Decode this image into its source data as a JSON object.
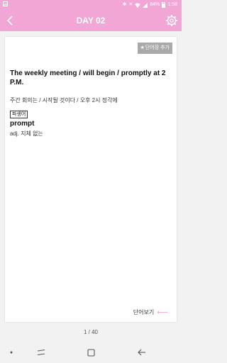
{
  "status_bar": {
    "battery": "84%",
    "time": "1:58"
  },
  "header": {
    "title": "DAY 02"
  },
  "card": {
    "add_word_label": "단어장 추가",
    "sentence": "The weekly meeting / will begin / promptly at 2 P.M.",
    "translation": "주간 회의는 / 시작될 것이다 / 오후 2시 정각에",
    "derivative_badge": "파생어",
    "word": "prompt",
    "word_definition": "adj. 지체 없는",
    "view_words_label": "단어보기"
  },
  "pagination": {
    "indicator": "1 / 40"
  },
  "colors": {
    "accent": "#f1a6d6",
    "button_gray": "#a9a9a9"
  },
  "icons": {
    "back": "chevron-left-icon",
    "settings": "gear-icon",
    "view_words": "arrow-left-icon"
  }
}
